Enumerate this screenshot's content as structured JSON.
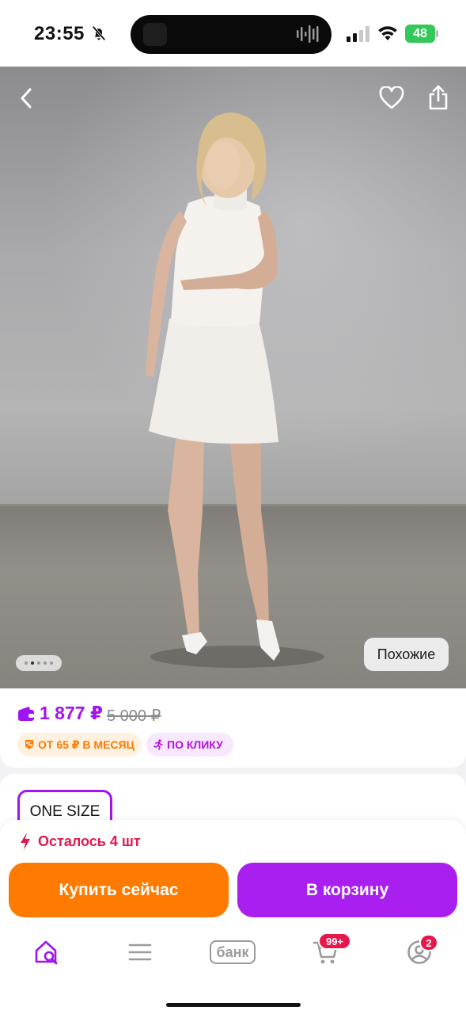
{
  "status_bar": {
    "time": "23:55",
    "battery": "48",
    "icons": [
      "bell-slash-icon",
      "signal-icon",
      "wifi-icon",
      "battery-charging-icon"
    ]
  },
  "gallery": {
    "similar_label": "Похожие",
    "page_count": 5,
    "active_index": 1
  },
  "price": {
    "current": "1 877 ₽",
    "old": "5 000 ₽",
    "badges": [
      {
        "label": "ОТ 65 ₽ В МЕСЯЦ",
        "icon": "installment-icon"
      },
      {
        "label": "ПО КЛИКУ",
        "icon": "running-man-icon"
      }
    ]
  },
  "options": {
    "size_label": "ONE SIZE"
  },
  "purchase": {
    "stock_text": "Осталось 4 шт",
    "buy_now_label": "Купить сейчас",
    "add_to_cart_label": "В корзину"
  },
  "tabbar": {
    "bank_label": "банк",
    "cart_badge": "99+",
    "profile_badge": "2"
  },
  "colors": {
    "accent_purple": "#a113f0",
    "buy_orange": "#ff7b00",
    "cart_purple": "#a91ff0",
    "alert_red": "#e0184f"
  }
}
